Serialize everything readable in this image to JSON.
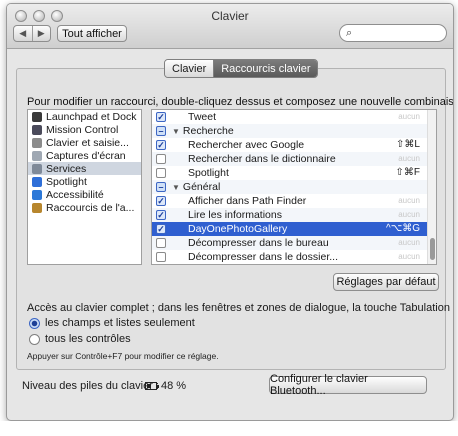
{
  "window": {
    "title": "Clavier",
    "show_all_label": "Tout afficher",
    "nav_back": "◀",
    "nav_forward": "▶",
    "search_value": ""
  },
  "tabs": [
    {
      "label": "Clavier",
      "active": false
    },
    {
      "label": "Raccourcis clavier",
      "active": true
    }
  ],
  "instruction": "Pour modifier un raccourci, double-cliquez dessus et composez une nouvelle combinaison.",
  "categories": [
    {
      "label": "Launchpad et Dock",
      "icon": "launchpad-icon",
      "color": "#3a3a3a",
      "selected": false
    },
    {
      "label": "Mission Control",
      "icon": "mission-control-icon",
      "color": "#4a4a5a",
      "selected": false
    },
    {
      "label": "Clavier et saisie...",
      "icon": "keyboard-icon",
      "color": "#8c8c8c",
      "selected": false
    },
    {
      "label": "Captures d'écran",
      "icon": "screenshot-icon",
      "color": "#9fa8b3",
      "selected": false
    },
    {
      "label": "Services",
      "icon": "services-gear-icon",
      "color": "#7f8a99",
      "selected": true
    },
    {
      "label": "Spotlight",
      "icon": "spotlight-icon",
      "color": "#2f6fd8",
      "selected": false
    },
    {
      "label": "Accessibilité",
      "icon": "accessibility-icon",
      "color": "#2c78d8",
      "selected": false
    },
    {
      "label": "Raccourcis de l'a...",
      "icon": "app-shortcuts-icon",
      "color": "#b7862d",
      "selected": false
    }
  ],
  "shortcuts": [
    {
      "kind": "item",
      "label": "Tweet",
      "checked": true,
      "shortcut": "aucun",
      "placeholder": true,
      "selected": false
    },
    {
      "kind": "group",
      "label": "Recherche",
      "checked": "mixed",
      "shortcut": "",
      "placeholder": false,
      "selected": false
    },
    {
      "kind": "item",
      "label": "Rechercher avec Google",
      "checked": true,
      "shortcut": "⇧⌘L",
      "placeholder": false,
      "selected": false
    },
    {
      "kind": "item",
      "label": "Rechercher dans le dictionnaire",
      "checked": false,
      "shortcut": "aucun",
      "placeholder": true,
      "selected": false
    },
    {
      "kind": "item",
      "label": "Spotlight",
      "checked": false,
      "shortcut": "⇧⌘F",
      "placeholder": false,
      "selected": false
    },
    {
      "kind": "group",
      "label": "Général",
      "checked": "mixed",
      "shortcut": "",
      "placeholder": false,
      "selected": false
    },
    {
      "kind": "item",
      "label": "Afficher dans Path Finder",
      "checked": true,
      "shortcut": "aucun",
      "placeholder": true,
      "selected": false
    },
    {
      "kind": "item",
      "label": "Lire les informations",
      "checked": true,
      "shortcut": "aucun",
      "placeholder": true,
      "selected": false
    },
    {
      "kind": "item",
      "label": "DayOnePhotoGallery",
      "checked": true,
      "shortcut": "^⌥⌘G",
      "placeholder": false,
      "selected": true
    },
    {
      "kind": "item",
      "label": "Décompresser dans le bureau",
      "checked": false,
      "shortcut": "aucun",
      "placeholder": true,
      "selected": false
    },
    {
      "kind": "item",
      "label": "Décompresser dans le dossier...",
      "checked": false,
      "shortcut": "aucun",
      "placeholder": true,
      "selected": false
    }
  ],
  "defaults_button": "Réglages par défaut",
  "full_access": {
    "text": "Accès au clavier complet ; dans les fenêtres et zones de dialogue, la touche Tabulation activera :",
    "options": [
      {
        "label": "les champs et listes seulement",
        "selected": true
      },
      {
        "label": "tous les contrôles",
        "selected": false
      }
    ],
    "hint": "Appuyer sur Contrôle+F7 pour modifier ce réglage."
  },
  "battery": {
    "label": "Niveau des piles du clavier :",
    "value": "48 %"
  },
  "bluetooth_button": "Configurer le clavier Bluetooth..."
}
